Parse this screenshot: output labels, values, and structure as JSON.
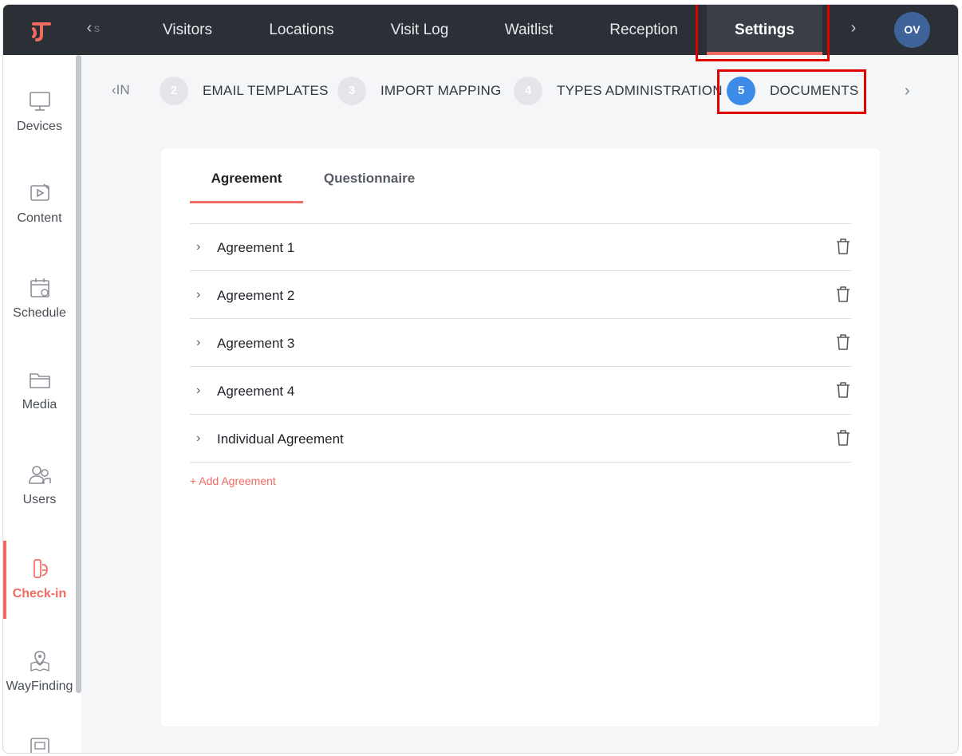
{
  "topnav": {
    "items": [
      {
        "label": "Visitors"
      },
      {
        "label": "Locations"
      },
      {
        "label": "Visit Log"
      },
      {
        "label": "Waitlist"
      },
      {
        "label": "Reception"
      },
      {
        "label": "Settings"
      }
    ],
    "left_arrow": "‹",
    "left_ghost": "s",
    "right_arrow": "›",
    "avatar_initials": "OV"
  },
  "sidebar": {
    "items": [
      {
        "label": "Devices",
        "icon": "monitor-icon"
      },
      {
        "label": "Content",
        "icon": "content-icon"
      },
      {
        "label": "Schedule",
        "icon": "calendar-icon"
      },
      {
        "label": "Media",
        "icon": "folder-icon"
      },
      {
        "label": "Users",
        "icon": "users-icon"
      },
      {
        "label": "Check-in",
        "icon": "check-in-icon",
        "active": true
      },
      {
        "label": "WayFinding",
        "icon": "map-pin-icon"
      }
    ]
  },
  "stepper": {
    "prev_label": "‹IN",
    "steps": [
      {
        "num": "2",
        "label": "EMAIL TEMPLATES"
      },
      {
        "num": "3",
        "label": "IMPORT MAPPING"
      },
      {
        "num": "4",
        "label": "TYPES ADMINISTRATION"
      },
      {
        "num": "5",
        "label": "DOCUMENTS",
        "active": true
      }
    ],
    "next_arrow": "›"
  },
  "tabs": [
    {
      "label": "Agreement",
      "active": true
    },
    {
      "label": "Questionnaire"
    }
  ],
  "agreements": [
    {
      "name": "Agreement 1"
    },
    {
      "name": "Agreement 2"
    },
    {
      "name": "Agreement 3"
    },
    {
      "name": "Agreement 4"
    },
    {
      "name": "Individual Agreement"
    }
  ],
  "chevron": "›",
  "add_agreement_label": "+ Add Agreement",
  "colors": {
    "accent": "#f26b63",
    "topbar": "#2b2f36",
    "active_step": "#3d8be8",
    "avatar": "#3d6399",
    "highlight": "#e00000"
  }
}
